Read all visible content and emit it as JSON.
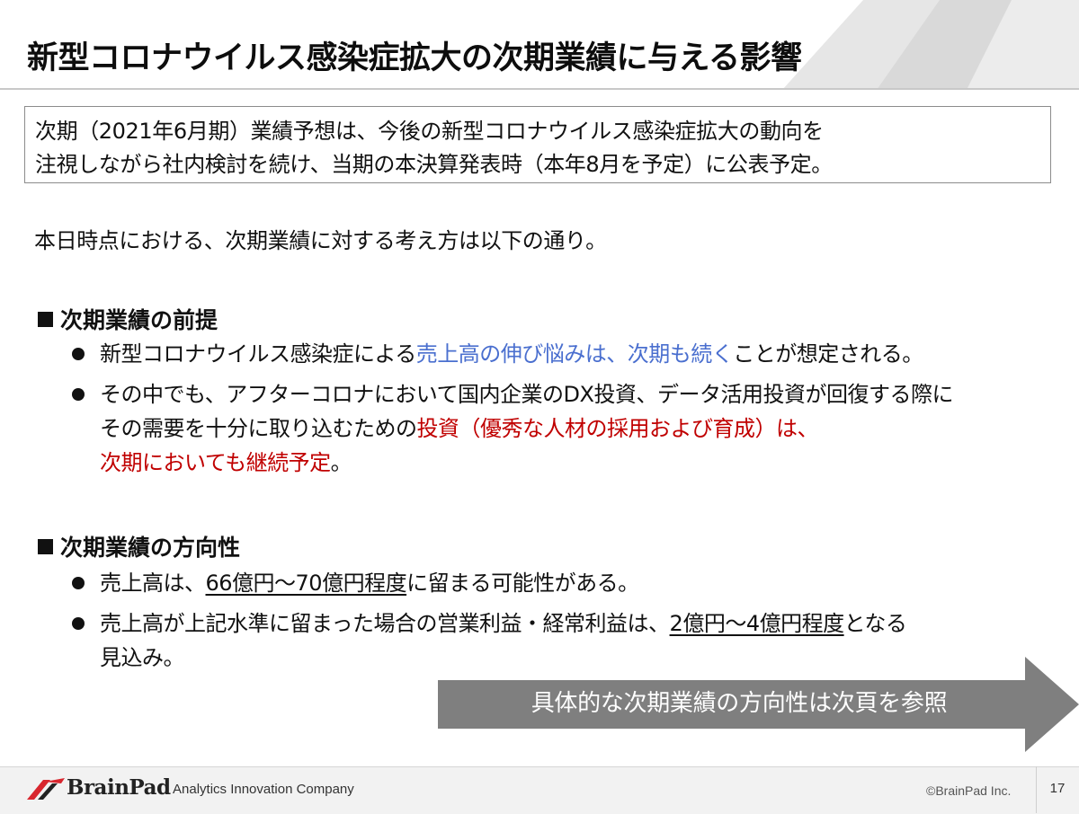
{
  "title": "新型コロナウイルス感染症拡大の次期業績に与える影響",
  "notice": {
    "line1": "次期（2021年6月期）業績予想は、今後の新型コロナウイルス感染症拡大の動向を",
    "line2": "注視しながら社内検討を続け、当期の本決算発表時（本年8月を予定）に公表予定。"
  },
  "intro": "本日時点における、次期業績に対する考え方は以下の通り。",
  "section_premise": {
    "heading": "次期業績の前提",
    "bullet1": {
      "pre": "新型コロナウイルス感染症による",
      "highlight": "売上高の伸び悩みは、次期も続く",
      "post": "ことが想定される。"
    },
    "bullet2": {
      "line1": "その中でも、アフターコロナにおいて国内企業のDX投資、データ活用投資が回復する際に",
      "line2_pre": "その需要を十分に取り込むための",
      "line2_highlight": "投資（優秀な人材の採用および育成）は、",
      "line3_highlight": "次期においても継続予定",
      "line3_post": "。"
    }
  },
  "section_direction": {
    "heading": "次期業績の方向性",
    "bullet1": {
      "pre": "売上高は、",
      "underlined": "66億円～70億円程度",
      "post": "に留まる可能性がある。"
    },
    "bullet2": {
      "pre": "売上高が上記水準に留まった場合の営業利益・経常利益は、",
      "underlined": "2億円～4億円程度",
      "post": "となる",
      "line2": "見込み。"
    }
  },
  "callout": "具体的な次期業績の方向性は次頁を参照",
  "footer": {
    "logo_text": "BrainPad",
    "tagline": "Analytics Innovation Company",
    "copyright": "©BrainPad Inc.",
    "page_number": "17"
  },
  "colors": {
    "blue_highlight": "#4a6fcf",
    "red_highlight": "#c00000",
    "arrow_gray": "#7f7f7f",
    "logo_red": "#d8262e"
  }
}
